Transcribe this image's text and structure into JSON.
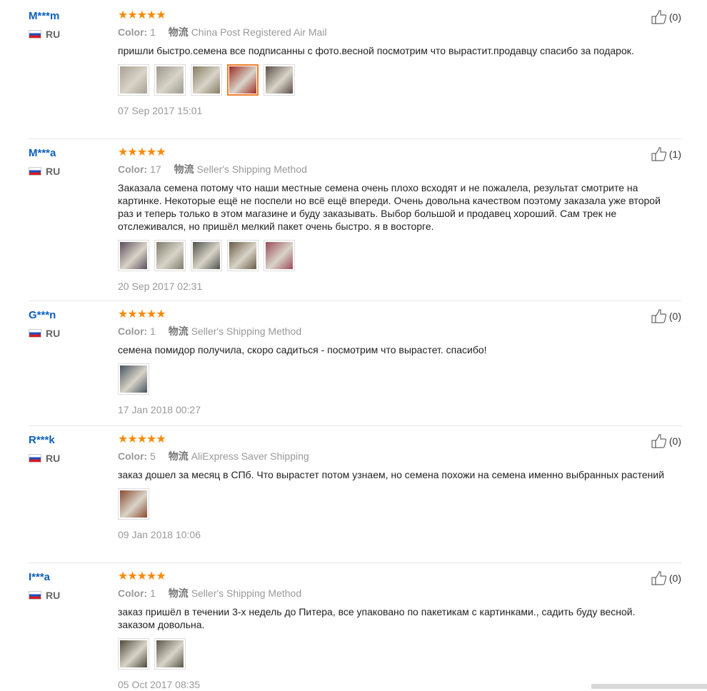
{
  "reviews": [
    {
      "user": "M***m",
      "country": "RU",
      "stars": "★★★★★",
      "color_label": "Color:",
      "color_value": "1",
      "shipping_label": "物流",
      "shipping_value": "China Post Registered Air Mail",
      "text": "пришли быстро.семена все подписанны с фото.весной посмотрим что вырастит.продавцу спасибо за подарок.",
      "date": "07 Sep 2017 15:01",
      "helpful": "(0)",
      "thumbs": [
        "#a8a194",
        "#9a978c",
        "#857c62",
        "#9c2d24",
        "#5a4e48"
      ],
      "active_thumb": 3
    },
    {
      "user": "M***a",
      "country": "RU",
      "stars": "★★★★★",
      "color_label": "Color:",
      "color_value": "17",
      "shipping_label": "物流",
      "shipping_value": "Seller's Shipping Method",
      "text": "Заказала семена потому что наши местные семена очень плохо всходят и не пожалела, результат смотрите на картинке. Некоторые ещё не поспели но всё ещё впереди. Очень довольна качеством поэтому заказала уже второй раз и теперь только в этом магазине и буду заказывать. Выбор большой и продавец хороший. Сам трек не отслеживался, но пришёл мелкий пакет очень быстро. я в восторге.",
      "date": "20 Sep 2017 02:31",
      "helpful": "(1)",
      "thumbs": [
        "#5c4d5e",
        "#7d7c6a",
        "#4f524a",
        "#6a5c46",
        "#9b4b5c"
      ],
      "active_thumb": -1
    },
    {
      "user": "G***n",
      "country": "RU",
      "stars": "★★★★★",
      "color_label": "Color:",
      "color_value": "1",
      "shipping_label": "物流",
      "shipping_value": "Seller's Shipping Method",
      "text": "семена помидор получила, скоро садиться - посмотрим что вырастет. спасибо!",
      "date": "17 Jan 2018 00:27",
      "helpful": "(0)",
      "thumbs": [
        "#46535f"
      ],
      "active_thumb": -1
    },
    {
      "user": "R***k",
      "country": "RU",
      "stars": "★★★★★",
      "color_label": "Color:",
      "color_value": "5",
      "shipping_label": "物流",
      "shipping_value": "AliExpress Saver Shipping",
      "text": "заказ дошел за месяц в СПб. Что вырастет потом узнаем, но семена похожи на семена именно выбранных растений",
      "date": "09 Jan 2018 10:06",
      "helpful": "(0)",
      "thumbs": [
        "#8b4a32"
      ],
      "active_thumb": -1
    },
    {
      "user": "I***a",
      "country": "RU",
      "stars": "★★★★★",
      "color_label": "Color:",
      "color_value": "1",
      "shipping_label": "物流",
      "shipping_value": "Seller's Shipping Method",
      "text": "заказ пришёл в течении 3-х недель до Питера, все упаковано по пакетикам с картинками., садить буду весной. заказом довольна.",
      "date": "05 Oct 2017 08:35",
      "helpful": "(0)",
      "thumbs": [
        "#4d4a3a",
        "#59574a"
      ],
      "active_thumb": -1
    }
  ]
}
